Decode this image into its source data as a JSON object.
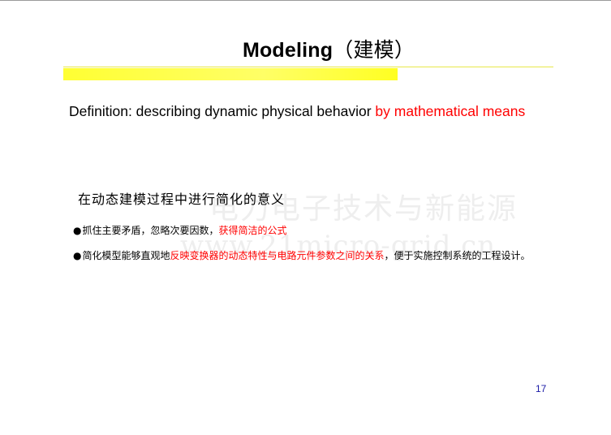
{
  "slide": {
    "title_en": "Modeling",
    "title_cn": "（建模）",
    "definition_prefix": "Definition: describing dynamic physical behavior ",
    "definition_highlight": "by mathematical means",
    "subheading": "在动态建模过程中进行简化的意义",
    "bullets": [
      {
        "marker": "●",
        "text_before": "抓住主要矛盾，忽略次要因数，",
        "highlight": "获得简洁的公式",
        "text_after": ""
      },
      {
        "marker": "●",
        "text_before": "简化模型能够直观地",
        "highlight": "反映变换器的动态特性与电路元件参数之间的关系",
        "text_after": "，便于实施控制系统的工程设计。"
      }
    ],
    "page_number": "17"
  },
  "watermark": {
    "line1": "电力电子技术与新能源",
    "line2": "www.21micro-grid.cn"
  },
  "colors": {
    "highlight_text": "#ff0000",
    "title_bar": "#ffff33",
    "page_number": "#1a1aa6"
  }
}
